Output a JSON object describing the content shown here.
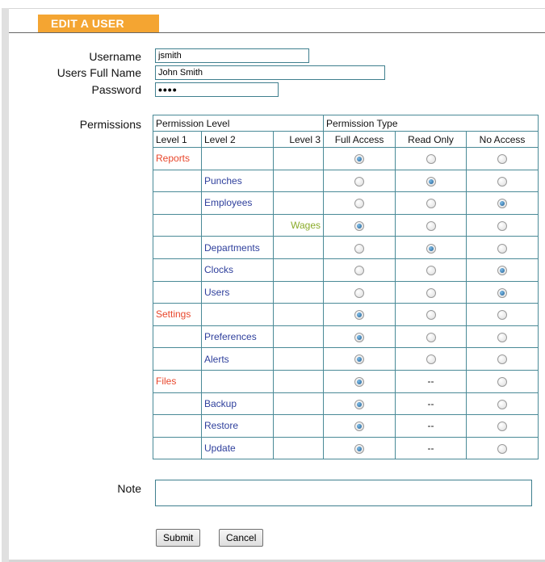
{
  "header": {
    "title": "EDIT A USER"
  },
  "form": {
    "username_label": "Username",
    "username_value": "jsmith",
    "fullname_label": "Users Full Name",
    "fullname_value": "John Smith",
    "password_label": "Password",
    "password_value": "••••",
    "permissions_label": "Permissions",
    "note_label": "Note",
    "note_value": ""
  },
  "permissions": {
    "level_header": "Permission Level",
    "type_header": "Permission Type",
    "level1": "Level 1",
    "level2": "Level 2",
    "level3": "Level 3",
    "full_access": "Full Access",
    "read_only": "Read Only",
    "no_access": "No Access",
    "rows": [
      {
        "label": "Reports",
        "level": 1,
        "selected": "full"
      },
      {
        "label": "Punches",
        "level": 2,
        "selected": "read"
      },
      {
        "label": "Employees",
        "level": 2,
        "selected": "none"
      },
      {
        "label": "Wages",
        "level": 3,
        "selected": "full"
      },
      {
        "label": "Departments",
        "level": 2,
        "selected": "read"
      },
      {
        "label": "Clocks",
        "level": 2,
        "selected": "none"
      },
      {
        "label": "Users",
        "level": 2,
        "selected": "none"
      },
      {
        "label": "Settings",
        "level": 1,
        "selected": "full"
      },
      {
        "label": "Preferences",
        "level": 2,
        "selected": "full"
      },
      {
        "label": "Alerts",
        "level": 2,
        "selected": "full"
      },
      {
        "label": "Files",
        "level": 1,
        "selected": "full",
        "read_text": "--"
      },
      {
        "label": "Backup",
        "level": 2,
        "selected": "full",
        "read_text": "--"
      },
      {
        "label": "Restore",
        "level": 2,
        "selected": "full",
        "read_text": "--"
      },
      {
        "label": "Update",
        "level": 2,
        "selected": "full",
        "read_text": "--"
      }
    ]
  },
  "buttons": {
    "submit": "Submit",
    "cancel": "Cancel"
  },
  "colors": {
    "header_orange": "#f4a532",
    "level1": "#e8472c",
    "level2": "#2e3f9c",
    "level3": "#8aab2a",
    "border_teal": "#4a8a97"
  }
}
